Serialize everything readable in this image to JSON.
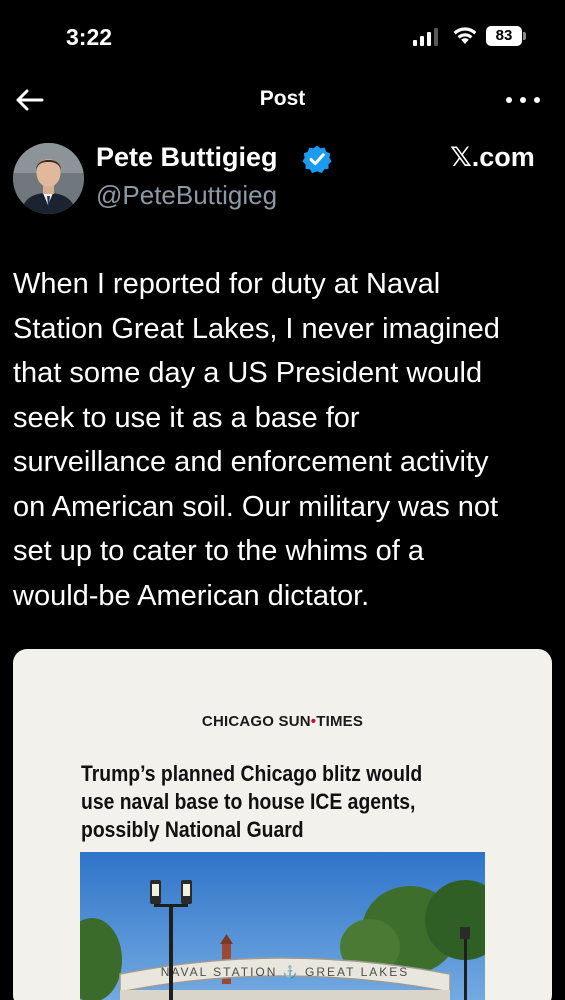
{
  "status_bar": {
    "time": "3:22",
    "battery": "83"
  },
  "nav": {
    "title": "Post",
    "back_icon": "back-arrow-icon",
    "more_icon": "more-options-icon"
  },
  "author": {
    "display_name": "Pete Buttigieg",
    "handle": "@PeteButtigieg",
    "verified": true,
    "badge_color": "#1d9bf0"
  },
  "source_label": "𝕏.com",
  "tweet": {
    "lines": [
      "When I reported for duty at Naval",
      "Station Great Lakes, I never imagined",
      "that some day a US President would",
      "seek to use it as a base for",
      "surveillance and enforcement activity",
      "on American soil. Our military was not",
      "set up to cater to the whims of a",
      "would-be American dictator."
    ]
  },
  "media": {
    "masthead_left": "CHICAGO SUN",
    "masthead_dot": "•",
    "masthead_right": "TIMES",
    "headline_lines": [
      "Trump’s planned Chicago blitz would",
      "use naval base to house ICE agents,",
      "possibly National Guard"
    ],
    "gate_text": "NAVAL STATION ⚓ GREAT LAKES"
  },
  "colors": {
    "background": "#000000",
    "text": "#ffffff",
    "secondary_text": "#8b98a5",
    "card_background": "#f2f1ec",
    "masthead_accent": "#c8102e"
  }
}
